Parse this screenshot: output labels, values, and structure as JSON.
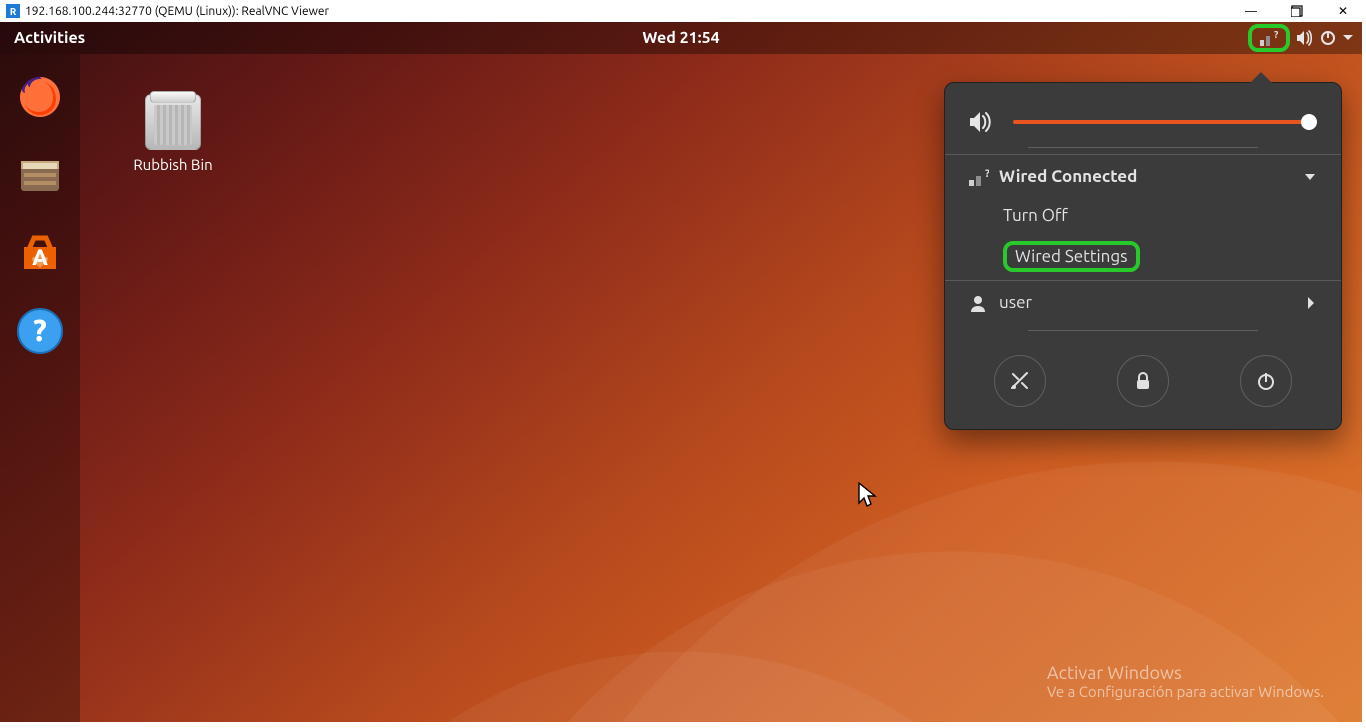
{
  "window": {
    "title": "192.168.100.244:32770 (QEMU (Linux)): RealVNC Viewer",
    "vnc_badge": "R"
  },
  "topbar": {
    "activities": "Activities",
    "clock": "Wed 21:54",
    "tray_icons": [
      "network-question-icon",
      "volume-icon",
      "power-icon",
      "chevron-down-icon"
    ]
  },
  "desktop": {
    "trash_label": "Rubbish Bin"
  },
  "dock": {
    "items": [
      "firefox-icon",
      "files-icon",
      "software-icon",
      "help-icon"
    ]
  },
  "popover": {
    "volume_pct": 100,
    "network": {
      "label": "Wired Connected",
      "sub": [
        "Turn Off",
        "Wired Settings"
      ]
    },
    "user": {
      "label": "user"
    },
    "buttons": [
      "settings-icon",
      "lock-icon",
      "power-icon"
    ]
  },
  "watermark": {
    "title": "Activar Windows",
    "sub": "Ve a Configuración para activar Windows."
  }
}
